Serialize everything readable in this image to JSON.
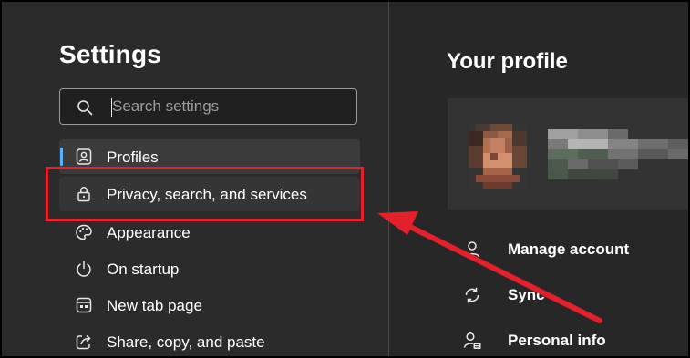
{
  "settings": {
    "title": "Settings",
    "search": {
      "placeholder": "Search settings",
      "value": ""
    },
    "nav_items": [
      {
        "label": "Profiles",
        "icon": "profiles-icon",
        "selected": true
      },
      {
        "label": "Privacy, search, and services",
        "icon": "lock-icon",
        "selected": false
      },
      {
        "label": "Appearance",
        "icon": "palette-icon",
        "selected": false
      },
      {
        "label": "On startup",
        "icon": "power-icon",
        "selected": false
      },
      {
        "label": "New tab page",
        "icon": "new-tab-icon",
        "selected": false
      },
      {
        "label": "Share, copy, and paste",
        "icon": "share-icon",
        "selected": false
      }
    ]
  },
  "profile": {
    "title": "Your profile",
    "menu": [
      {
        "label": "Manage account",
        "icon": "person-icon"
      },
      {
        "label": "Sync",
        "icon": "sync-icon"
      },
      {
        "label": "Personal info",
        "icon": "personal-info-icon"
      }
    ]
  },
  "annotation": {
    "color": "#e4202a"
  },
  "colors": {
    "accent": "#5bb0f5",
    "background": "#2b2b2b",
    "text": "#ffffff"
  }
}
